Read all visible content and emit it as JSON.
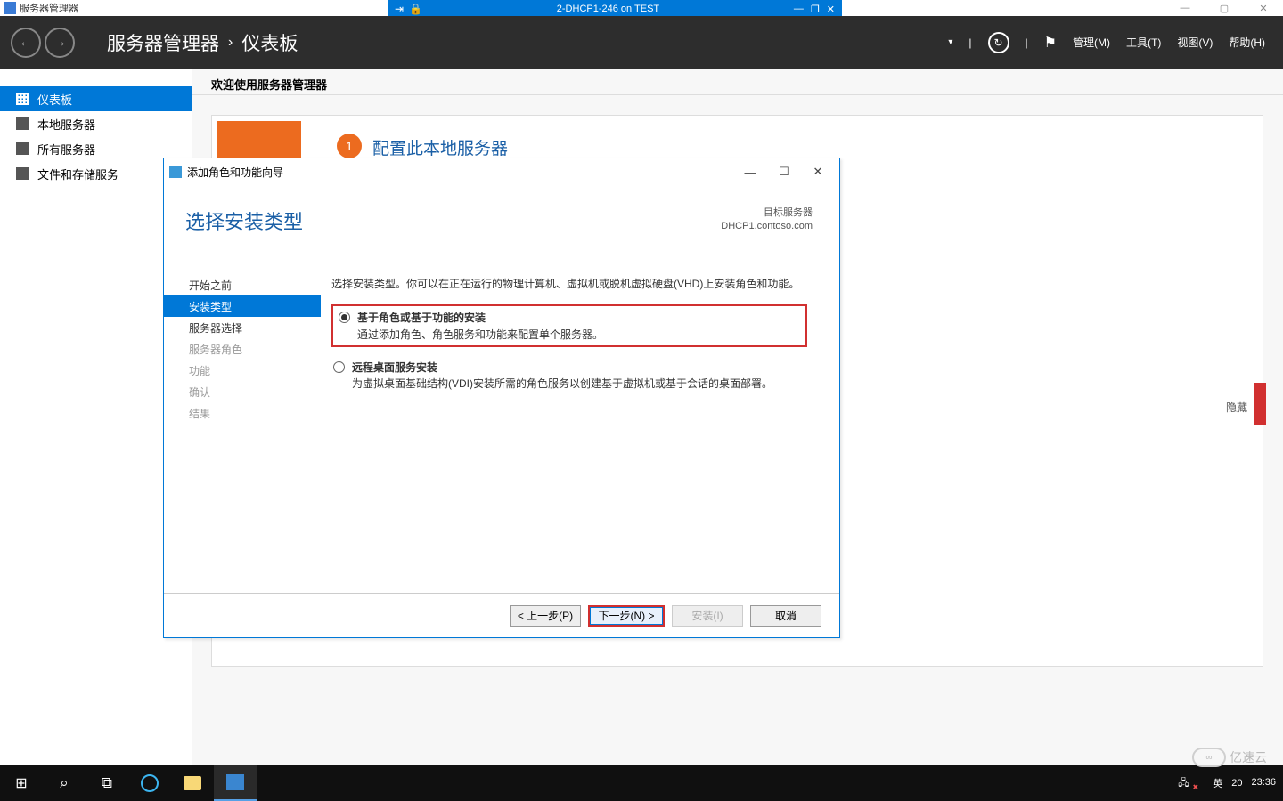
{
  "outer_window": {
    "title": "服务器管理器"
  },
  "vm_bar": {
    "title": "2-DHCP1-246 on TEST"
  },
  "header": {
    "crumb_app": "服务器管理器",
    "crumb_page": "仪表板",
    "menu": {
      "manage": "管理(M)",
      "tools": "工具(T)",
      "view": "视图(V)",
      "help": "帮助(H)"
    }
  },
  "sidebar": {
    "items": [
      {
        "label": "仪表板"
      },
      {
        "label": "本地服务器"
      },
      {
        "label": "所有服务器"
      },
      {
        "label": "文件和存储服务"
      }
    ]
  },
  "main": {
    "welcome": "欢迎使用服务器管理器",
    "step1_num": "1",
    "step1_text": "配置此本地服务器",
    "hide": "隐藏"
  },
  "wizard": {
    "title_bar": "添加角色和功能向导",
    "heading": "选择安装类型",
    "target_label": "目标服务器",
    "target_server": "DHCP1.contoso.com",
    "nav": [
      {
        "label": "开始之前",
        "state": "clickable"
      },
      {
        "label": "安装类型",
        "state": "selected"
      },
      {
        "label": "服务器选择",
        "state": "clickable"
      },
      {
        "label": "服务器角色",
        "state": "disabled"
      },
      {
        "label": "功能",
        "state": "disabled"
      },
      {
        "label": "确认",
        "state": "disabled"
      },
      {
        "label": "结果",
        "state": "disabled"
      }
    ],
    "desc": "选择安装类型。你可以在正在运行的物理计算机、虚拟机或脱机虚拟硬盘(VHD)上安装角色和功能。",
    "opt1": {
      "title": "基于角色或基于功能的安装",
      "sub": "通过添加角色、角色服务和功能来配置单个服务器。"
    },
    "opt2": {
      "title": "远程桌面服务安装",
      "sub": "为虚拟桌面基础结构(VDI)安装所需的角色服务以创建基于虚拟机或基于会话的桌面部署。"
    },
    "buttons": {
      "prev": "< 上一步(P)",
      "next": "下一步(N) >",
      "install": "安装(I)",
      "cancel": "取消"
    }
  },
  "tray": {
    "ime": "英",
    "num": "20",
    "time": "23:36",
    "date": ""
  },
  "watermark": {
    "text": "亿速云"
  }
}
